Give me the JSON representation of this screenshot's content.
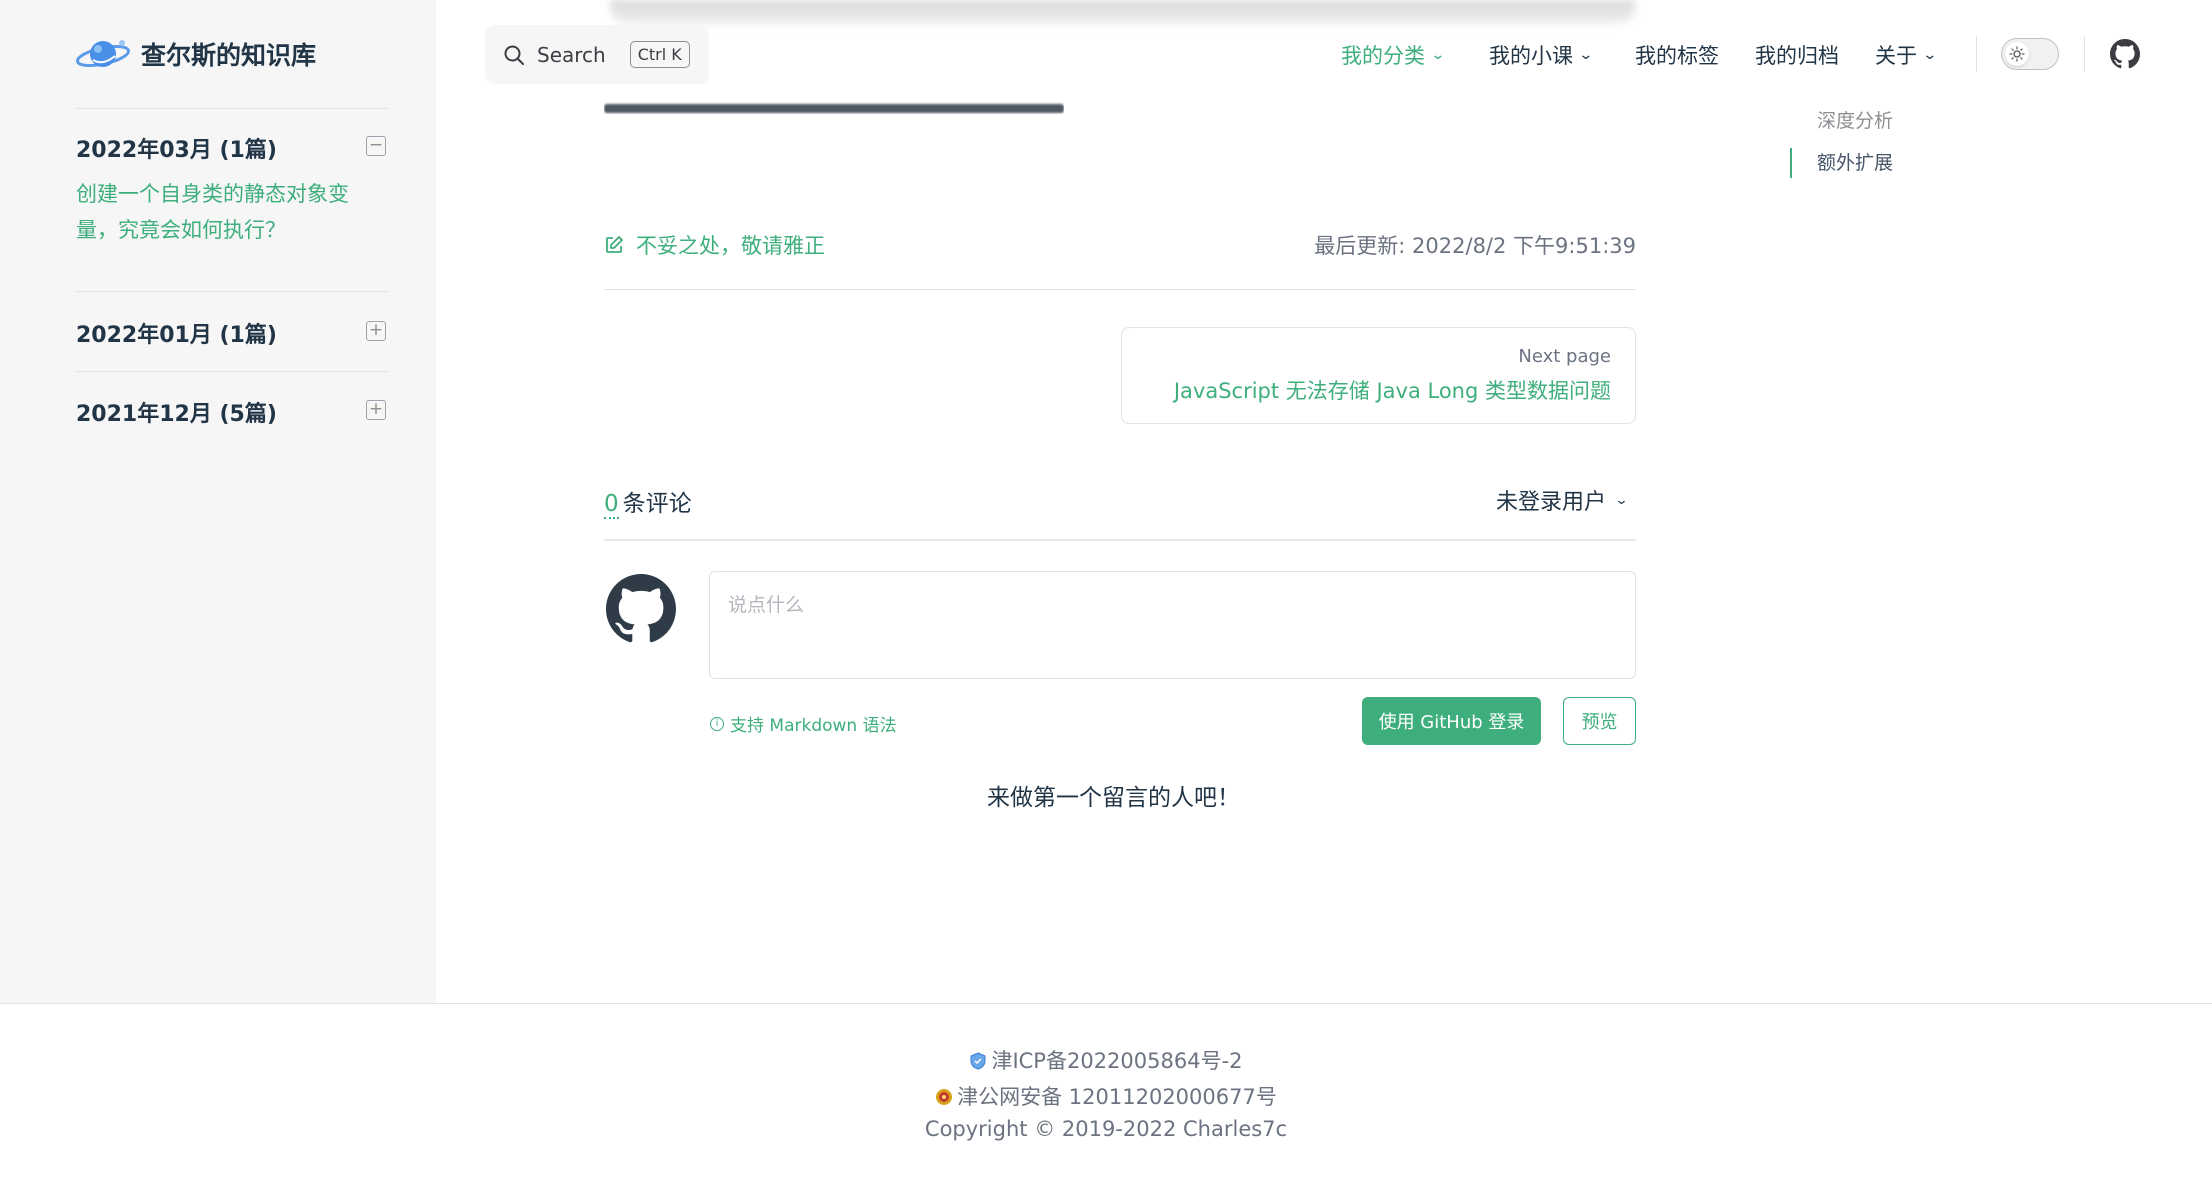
{
  "brand": {
    "title": "查尔斯的知识库"
  },
  "sidebar": {
    "groups": [
      {
        "title": "2022年03月 (1篇)",
        "toggle": "−",
        "items": [
          "创建一个自身类的静态对象变量，究竟会如何执行？"
        ]
      },
      {
        "title": "2022年01月 (1篇)",
        "toggle": "+"
      },
      {
        "title": "2021年12月 (5篇)",
        "toggle": "+"
      }
    ]
  },
  "search": {
    "label": "Search",
    "kbd": "Ctrl K"
  },
  "nav": {
    "items": [
      {
        "label": "我的分类",
        "dropdown": "⌄"
      },
      {
        "label": "我的小课",
        "dropdown": "⌄"
      },
      {
        "label": "我的标签"
      },
      {
        "label": "我的归档"
      },
      {
        "label": "关于",
        "dropdown": "⌄"
      }
    ],
    "active_color": "#3eaf7c"
  },
  "outline": {
    "items": [
      "深度分析",
      "额外扩展"
    ]
  },
  "doc": {
    "edit_link": "不妥之处，敬请雅正",
    "last_updated": "最后更新: 2022/8/2 下午9:51:39",
    "next": {
      "label": "Next page",
      "title": "JavaScript 无法存储 Java Long 类型数据问题"
    }
  },
  "comments": {
    "count": "0",
    "count_suffix": "条评论",
    "user": "未登录用户",
    "placeholder": "说点什么",
    "markdown_hint": "支持 Markdown 语法",
    "login_button": "使用 GitHub 登录",
    "preview_button": "预览",
    "empty": "来做第一个留言的人吧！"
  },
  "footer": {
    "icp": "津ICP备2022005864号-2",
    "police": "津公网安备 12011202000677号",
    "copyright": "Copyright © 2019-2022 Charles7c"
  }
}
